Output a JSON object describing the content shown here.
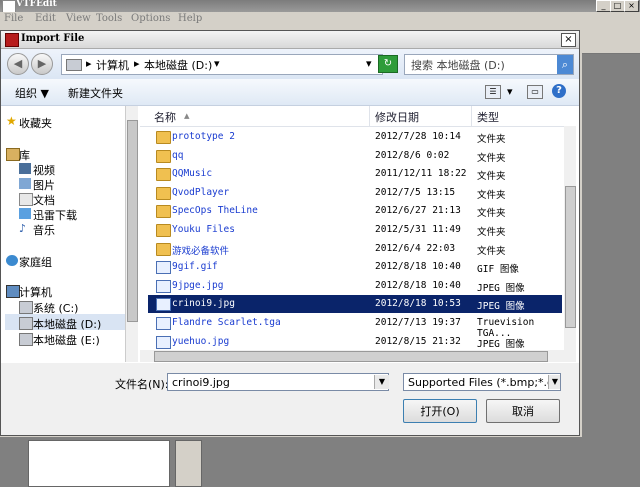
{
  "app": {
    "title": "VTFEdit",
    "menu": [
      "File",
      "Edit",
      "View",
      "Tools",
      "Options",
      "Help"
    ],
    "window_buttons": [
      "_",
      "□",
      "×"
    ]
  },
  "dialog": {
    "title": "Import File",
    "close": "×",
    "address": {
      "segments": [
        "计算机",
        "本地磁盘 (D:)"
      ],
      "separator": "▸",
      "dropdown": "▾"
    },
    "search_placeholder": "搜索 本地磁盘 (D:)",
    "toolbar": {
      "organize": "组织 ▼",
      "new_folder": "新建文件夹"
    },
    "nav": {
      "items": [
        {
          "label": "收藏夹",
          "icon": "star-icon"
        },
        {
          "label": "库",
          "icon": "library-icon"
        },
        {
          "label": "视频",
          "icon": "video-icon"
        },
        {
          "label": "图片",
          "icon": "pictures-icon"
        },
        {
          "label": "文档",
          "icon": "documents-icon"
        },
        {
          "label": "迅雷下载",
          "icon": "download-icon"
        },
        {
          "label": "音乐",
          "icon": "music-icon"
        },
        {
          "label": "家庭组",
          "icon": "homegroup-icon"
        },
        {
          "label": "计算机",
          "icon": "computer-icon"
        },
        {
          "label": "系统 (C:)",
          "icon": "drive-icon"
        },
        {
          "label": "本地磁盘 (D:)",
          "icon": "drive-icon"
        },
        {
          "label": "本地磁盘 (E:)",
          "icon": "drive-icon"
        }
      ]
    },
    "columns": {
      "name": "名称",
      "date": "修改日期",
      "type": "类型"
    },
    "files": [
      {
        "name": "prototype 2",
        "date": "2012/7/28 10:14",
        "type": "文件夹",
        "kind": "folder"
      },
      {
        "name": "qq",
        "date": "2012/8/6 0:02",
        "type": "文件夹",
        "kind": "folder"
      },
      {
        "name": "QQMusic",
        "date": "2011/12/11 18:22",
        "type": "文件夹",
        "kind": "folder"
      },
      {
        "name": "QvodPlayer",
        "date": "2012/7/5 13:15",
        "type": "文件夹",
        "kind": "folder"
      },
      {
        "name": "SpecOps TheLine",
        "date": "2012/6/27 21:13",
        "type": "文件夹",
        "kind": "folder"
      },
      {
        "name": "Youku Files",
        "date": "2012/5/31 11:49",
        "type": "文件夹",
        "kind": "folder"
      },
      {
        "name": "游戏必备软件",
        "date": "2012/6/4 22:03",
        "type": "文件夹",
        "kind": "folder"
      },
      {
        "name": "9gif.gif",
        "date": "2012/8/18 10:40",
        "type": "GIF 图像",
        "kind": "image"
      },
      {
        "name": "9jpge.jpg",
        "date": "2012/8/18 10:40",
        "type": "JPEG 图像",
        "kind": "image"
      },
      {
        "name": "crinoi9.jpg",
        "date": "2012/8/18 10:53",
        "type": "JPEG 图像",
        "kind": "image",
        "selected": true
      },
      {
        "name": "Flandre Scarlet.tga",
        "date": "2012/7/13 19:37",
        "type": "Truevision TGA...",
        "kind": "image"
      },
      {
        "name": "yuehuo.jpg",
        "date": "2012/8/15 21:32",
        "type": "JPEG 图像",
        "kind": "image"
      }
    ],
    "filename_label": "文件名(N):",
    "filename_value": "crinoi9.jpg",
    "filter_value": "Supported Files (*.bmp;*.dds",
    "open_label": "打开(O)",
    "cancel_label": "取消"
  }
}
